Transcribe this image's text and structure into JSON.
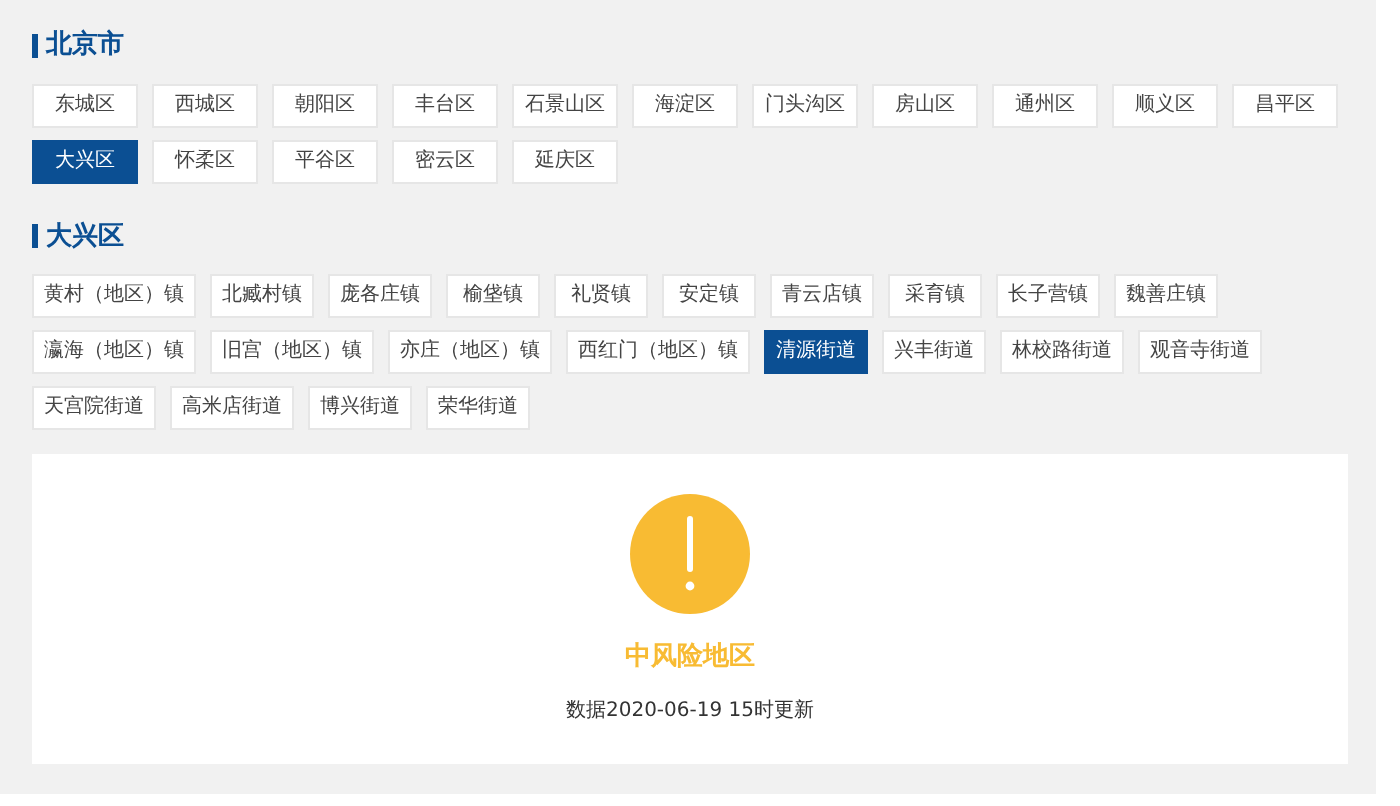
{
  "city": {
    "title": "北京市",
    "districts": [
      {
        "label": "东城区",
        "selected": false
      },
      {
        "label": "西城区",
        "selected": false
      },
      {
        "label": "朝阳区",
        "selected": false
      },
      {
        "label": "丰台区",
        "selected": false
      },
      {
        "label": "石景山区",
        "selected": false
      },
      {
        "label": "海淀区",
        "selected": false
      },
      {
        "label": "门头沟区",
        "selected": false
      },
      {
        "label": "房山区",
        "selected": false
      },
      {
        "label": "通州区",
        "selected": false
      },
      {
        "label": "顺义区",
        "selected": false
      },
      {
        "label": "昌平区",
        "selected": false
      },
      {
        "label": "大兴区",
        "selected": true
      },
      {
        "label": "怀柔区",
        "selected": false
      },
      {
        "label": "平谷区",
        "selected": false
      },
      {
        "label": "密云区",
        "selected": false
      },
      {
        "label": "延庆区",
        "selected": false
      }
    ]
  },
  "district": {
    "title": "大兴区",
    "towns": [
      {
        "label": "黄村（地区）镇",
        "selected": false
      },
      {
        "label": "北臧村镇",
        "selected": false
      },
      {
        "label": "庞各庄镇",
        "selected": false
      },
      {
        "label": "榆垡镇",
        "selected": false
      },
      {
        "label": "礼贤镇",
        "selected": false
      },
      {
        "label": "安定镇",
        "selected": false
      },
      {
        "label": "青云店镇",
        "selected": false
      },
      {
        "label": "采育镇",
        "selected": false
      },
      {
        "label": "长子营镇",
        "selected": false
      },
      {
        "label": "魏善庄镇",
        "selected": false
      },
      {
        "label": "瀛海（地区）镇",
        "selected": false
      },
      {
        "label": "旧宫（地区）镇",
        "selected": false
      },
      {
        "label": "亦庄（地区）镇",
        "selected": false
      },
      {
        "label": "西红门（地区）镇",
        "selected": false
      },
      {
        "label": "清源街道",
        "selected": true
      },
      {
        "label": "兴丰街道",
        "selected": false
      },
      {
        "label": "林校路街道",
        "selected": false
      },
      {
        "label": "观音寺街道",
        "selected": false
      },
      {
        "label": "天宫院街道",
        "selected": false
      },
      {
        "label": "高米店街道",
        "selected": false
      },
      {
        "label": "博兴街道",
        "selected": false
      },
      {
        "label": "荣华街道",
        "selected": false
      }
    ]
  },
  "result": {
    "risk": "中风险地区",
    "updated": "数据2020-06-19 15时更新"
  }
}
